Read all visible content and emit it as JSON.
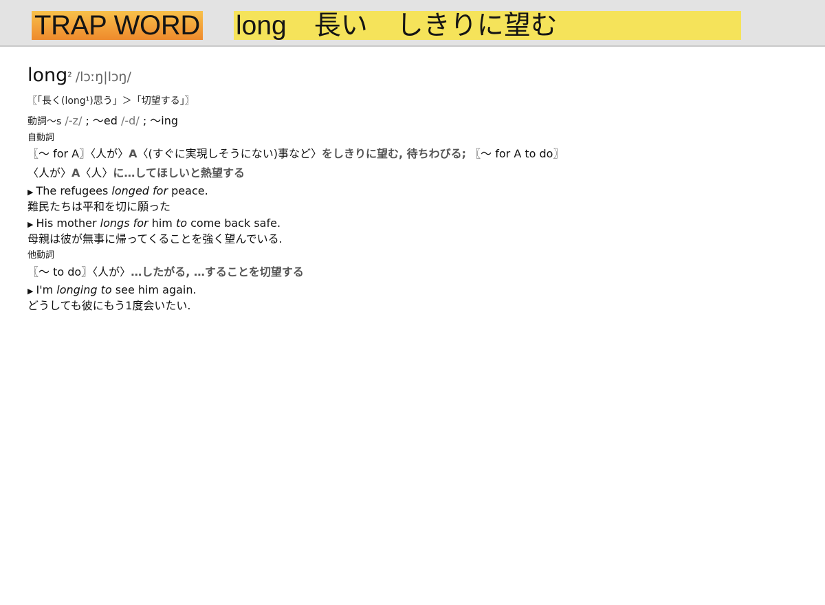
{
  "header": {
    "badge": "TRAP WORD",
    "word": "long",
    "meaning1": "長い",
    "meaning2": "しきりに望む"
  },
  "entry": {
    "headword": "long",
    "homograph": "2",
    "pronunciation": "/lɔːŋ|lɔŋ/",
    "etymology": "〖「長く(long¹)思う」＞「切望する」〗",
    "inflection": {
      "prefix": "動詞～s",
      "s_pron": "/-z/",
      "sep1": "; ～ed",
      "ed_pron": "/-d/",
      "sep2": "; ～ing"
    },
    "intransitive": {
      "pos": "自動詞",
      "pattern1": "〖～ for A〗〈人が〉",
      "a1": "A",
      "note1": "〈(すぐに実現しそうにない)事など〉",
      "def1": "をしきりに望む, 待ちわびる;",
      "pattern2": " 〖～ for A to do〗",
      "pattern3": "〈人が〉",
      "a2": "A",
      "note2": "〈人〉",
      "def2": "に…してほしいと熱望する",
      "ex1": {
        "pre": "The refugees ",
        "it": "longed for",
        "post": " peace.",
        "ja": "難民たちは平和を切に願った"
      },
      "ex2": {
        "pre": "His mother ",
        "it1": "longs for",
        "mid": " him ",
        "it2": "to",
        "post": " come back safe.",
        "ja": "母親は彼が無事に帰ってくることを強く望んでいる."
      }
    },
    "transitive": {
      "pos": "他動詞",
      "pattern": "〖～ to do〗〈人が〉",
      "def": "…したがる, …することを切望する",
      "ex1": {
        "pre": "I'm ",
        "it": "longing to",
        "post": " see him again.",
        "ja": "どうしても彼にもう1度会いたい."
      }
    }
  }
}
